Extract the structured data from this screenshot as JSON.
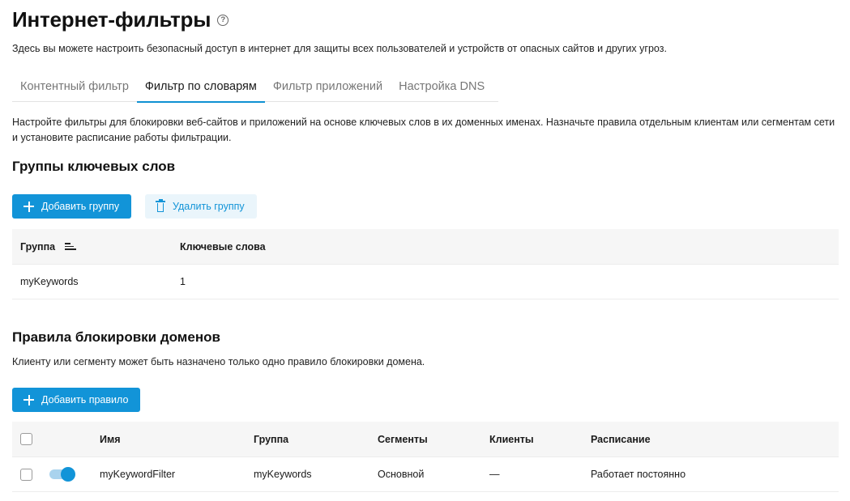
{
  "header": {
    "title": "Интернет-фильтры",
    "help_icon": "help-circle-icon",
    "description": "Здесь вы можете настроить безопасный доступ в интернет для защиты всех пользователей и устройств от опасных сайтов и других угроз."
  },
  "tabs": [
    {
      "label": "Контентный фильтр",
      "active": false
    },
    {
      "label": "Фильтр по словарям",
      "active": true
    },
    {
      "label": "Фильтр приложений",
      "active": false
    },
    {
      "label": "Настройка DNS",
      "active": false
    }
  ],
  "section_description": "Настройте фильтры для блокировки веб-сайтов и приложений на основе ключевых слов в их доменных именах. Назначьте правила отдельным клиентам или сегментам сети и установите расписание работы фильтрации.",
  "keyword_groups": {
    "title": "Группы ключевых слов",
    "add_label": "Добавить группу",
    "delete_label": "Удалить группу",
    "columns": {
      "group": "Группа",
      "keywords": "Ключевые слова"
    },
    "rows": [
      {
        "group": "myKeywords",
        "keywords": "1"
      }
    ]
  },
  "domain_rules": {
    "title": "Правила блокировки доменов",
    "description": "Клиенту или сегменту может быть назначено только одно правило блокировки домена.",
    "add_label": "Добавить правило",
    "columns": {
      "name": "Имя",
      "group": "Группа",
      "segments": "Сегменты",
      "clients": "Клиенты",
      "schedule": "Расписание"
    },
    "rows": [
      {
        "enabled": true,
        "name": "myKeywordFilter",
        "group": "myKeywords",
        "segments": "Основной",
        "clients": "—",
        "schedule": "Работает постоянно"
      }
    ]
  },
  "colors": {
    "accent": "#1294d8",
    "accent_light": "#eaf5fb",
    "header_bg": "#f6f6f6"
  }
}
